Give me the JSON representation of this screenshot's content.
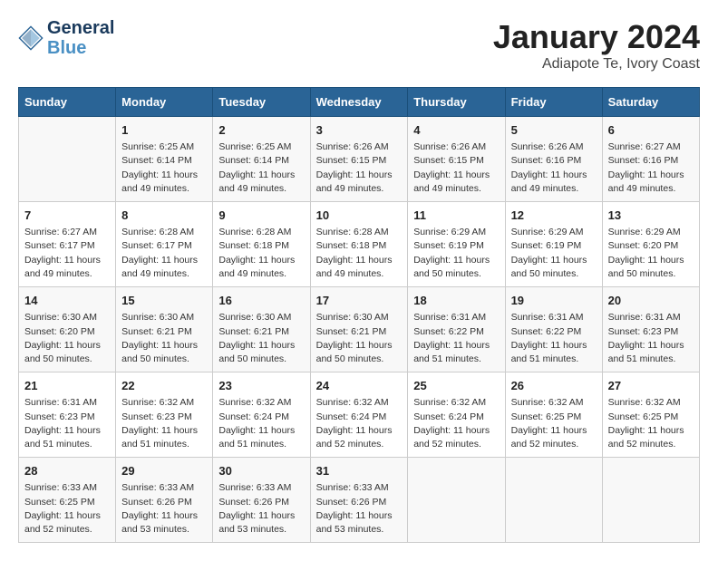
{
  "logo": {
    "line1": "General",
    "line2": "Blue"
  },
  "title": "January 2024",
  "location": "Adiapote Te, Ivory Coast",
  "days_of_week": [
    "Sunday",
    "Monday",
    "Tuesday",
    "Wednesday",
    "Thursday",
    "Friday",
    "Saturday"
  ],
  "weeks": [
    [
      {
        "num": "",
        "info": ""
      },
      {
        "num": "1",
        "info": "Sunrise: 6:25 AM\nSunset: 6:14 PM\nDaylight: 11 hours\nand 49 minutes."
      },
      {
        "num": "2",
        "info": "Sunrise: 6:25 AM\nSunset: 6:14 PM\nDaylight: 11 hours\nand 49 minutes."
      },
      {
        "num": "3",
        "info": "Sunrise: 6:26 AM\nSunset: 6:15 PM\nDaylight: 11 hours\nand 49 minutes."
      },
      {
        "num": "4",
        "info": "Sunrise: 6:26 AM\nSunset: 6:15 PM\nDaylight: 11 hours\nand 49 minutes."
      },
      {
        "num": "5",
        "info": "Sunrise: 6:26 AM\nSunset: 6:16 PM\nDaylight: 11 hours\nand 49 minutes."
      },
      {
        "num": "6",
        "info": "Sunrise: 6:27 AM\nSunset: 6:16 PM\nDaylight: 11 hours\nand 49 minutes."
      }
    ],
    [
      {
        "num": "7",
        "info": "Sunrise: 6:27 AM\nSunset: 6:17 PM\nDaylight: 11 hours\nand 49 minutes."
      },
      {
        "num": "8",
        "info": "Sunrise: 6:28 AM\nSunset: 6:17 PM\nDaylight: 11 hours\nand 49 minutes."
      },
      {
        "num": "9",
        "info": "Sunrise: 6:28 AM\nSunset: 6:18 PM\nDaylight: 11 hours\nand 49 minutes."
      },
      {
        "num": "10",
        "info": "Sunrise: 6:28 AM\nSunset: 6:18 PM\nDaylight: 11 hours\nand 49 minutes."
      },
      {
        "num": "11",
        "info": "Sunrise: 6:29 AM\nSunset: 6:19 PM\nDaylight: 11 hours\nand 50 minutes."
      },
      {
        "num": "12",
        "info": "Sunrise: 6:29 AM\nSunset: 6:19 PM\nDaylight: 11 hours\nand 50 minutes."
      },
      {
        "num": "13",
        "info": "Sunrise: 6:29 AM\nSunset: 6:20 PM\nDaylight: 11 hours\nand 50 minutes."
      }
    ],
    [
      {
        "num": "14",
        "info": "Sunrise: 6:30 AM\nSunset: 6:20 PM\nDaylight: 11 hours\nand 50 minutes."
      },
      {
        "num": "15",
        "info": "Sunrise: 6:30 AM\nSunset: 6:21 PM\nDaylight: 11 hours\nand 50 minutes."
      },
      {
        "num": "16",
        "info": "Sunrise: 6:30 AM\nSunset: 6:21 PM\nDaylight: 11 hours\nand 50 minutes."
      },
      {
        "num": "17",
        "info": "Sunrise: 6:30 AM\nSunset: 6:21 PM\nDaylight: 11 hours\nand 50 minutes."
      },
      {
        "num": "18",
        "info": "Sunrise: 6:31 AM\nSunset: 6:22 PM\nDaylight: 11 hours\nand 51 minutes."
      },
      {
        "num": "19",
        "info": "Sunrise: 6:31 AM\nSunset: 6:22 PM\nDaylight: 11 hours\nand 51 minutes."
      },
      {
        "num": "20",
        "info": "Sunrise: 6:31 AM\nSunset: 6:23 PM\nDaylight: 11 hours\nand 51 minutes."
      }
    ],
    [
      {
        "num": "21",
        "info": "Sunrise: 6:31 AM\nSunset: 6:23 PM\nDaylight: 11 hours\nand 51 minutes."
      },
      {
        "num": "22",
        "info": "Sunrise: 6:32 AM\nSunset: 6:23 PM\nDaylight: 11 hours\nand 51 minutes."
      },
      {
        "num": "23",
        "info": "Sunrise: 6:32 AM\nSunset: 6:24 PM\nDaylight: 11 hours\nand 51 minutes."
      },
      {
        "num": "24",
        "info": "Sunrise: 6:32 AM\nSunset: 6:24 PM\nDaylight: 11 hours\nand 52 minutes."
      },
      {
        "num": "25",
        "info": "Sunrise: 6:32 AM\nSunset: 6:24 PM\nDaylight: 11 hours\nand 52 minutes."
      },
      {
        "num": "26",
        "info": "Sunrise: 6:32 AM\nSunset: 6:25 PM\nDaylight: 11 hours\nand 52 minutes."
      },
      {
        "num": "27",
        "info": "Sunrise: 6:32 AM\nSunset: 6:25 PM\nDaylight: 11 hours\nand 52 minutes."
      }
    ],
    [
      {
        "num": "28",
        "info": "Sunrise: 6:33 AM\nSunset: 6:25 PM\nDaylight: 11 hours\nand 52 minutes."
      },
      {
        "num": "29",
        "info": "Sunrise: 6:33 AM\nSunset: 6:26 PM\nDaylight: 11 hours\nand 53 minutes."
      },
      {
        "num": "30",
        "info": "Sunrise: 6:33 AM\nSunset: 6:26 PM\nDaylight: 11 hours\nand 53 minutes."
      },
      {
        "num": "31",
        "info": "Sunrise: 6:33 AM\nSunset: 6:26 PM\nDaylight: 11 hours\nand 53 minutes."
      },
      {
        "num": "",
        "info": ""
      },
      {
        "num": "",
        "info": ""
      },
      {
        "num": "",
        "info": ""
      }
    ]
  ]
}
